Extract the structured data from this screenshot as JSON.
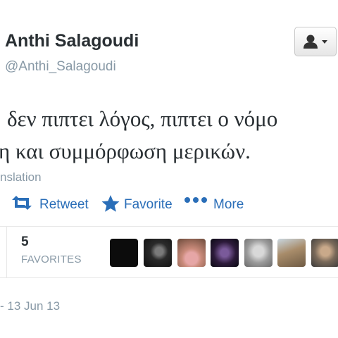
{
  "user": {
    "name": "Anthi Salagoudi",
    "handle": "@Anthi_Salagoudi"
  },
  "tweet": {
    "line1": "δεν πιπτει λόγος, πιπτει ο νόμο",
    "line2": "η και συμμόρφωση μερικών."
  },
  "translation_label": "nslation",
  "actions": {
    "retweet": "Retweet",
    "favorite": "Favorite",
    "more": "More"
  },
  "stats": {
    "favorites_count": "5",
    "favorites_label": "FAVORITES"
  },
  "timestamp": "- 13 Jun 13",
  "icons": {
    "follow": "user-dropdown-icon",
    "retweet": "retweet-icon",
    "favorite": "star-icon",
    "more": "more-dots-icon"
  },
  "colors": {
    "action_blue": "#2a6eb8",
    "muted_gray": "#8899a6",
    "text_dark": "#292f33"
  }
}
